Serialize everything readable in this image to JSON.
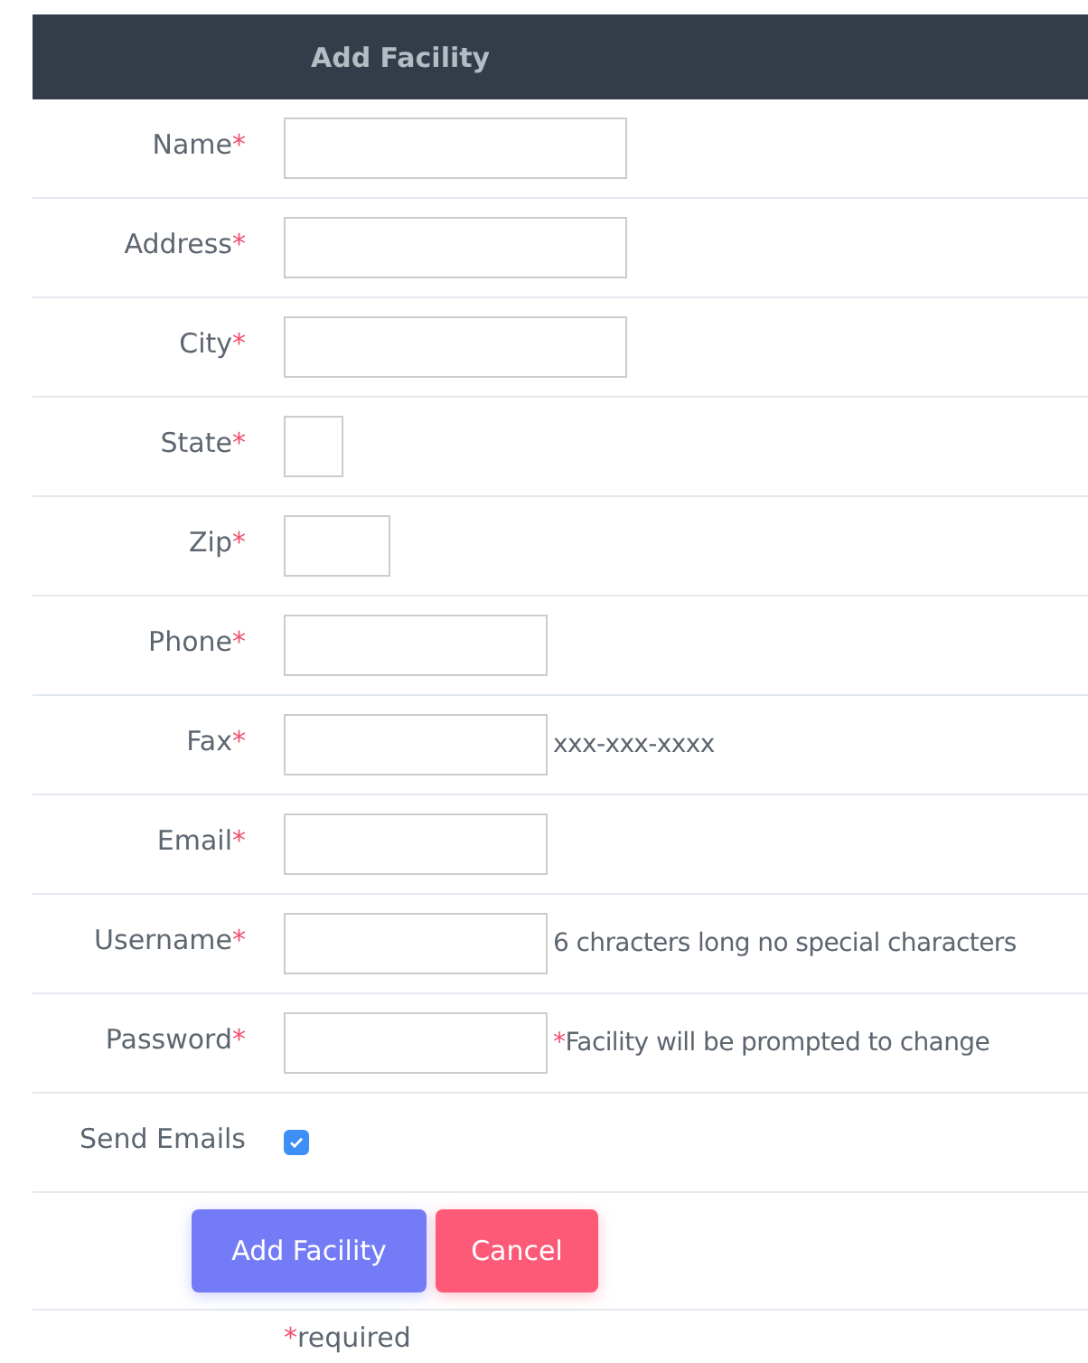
{
  "header": {
    "title": "Add Facility"
  },
  "fields": [
    {
      "kind": "wide",
      "label": "Name",
      "mark": "*"
    },
    {
      "kind": "wide",
      "label": "Address",
      "mark": "*"
    },
    {
      "kind": "wide",
      "label": "City",
      "mark": "*"
    },
    {
      "kind": "tiny",
      "label": "State",
      "mark": "*"
    },
    {
      "kind": "short",
      "label": "Zip",
      "mark": "*"
    },
    {
      "kind": "medium",
      "label": "Phone",
      "mark": "*"
    },
    {
      "kind": "medium",
      "label": "Fax",
      "mark": "*",
      "hint": "xxx-xxx-xxxx"
    },
    {
      "kind": "medium",
      "label": "Email",
      "mark": "*"
    },
    {
      "kind": "medium",
      "label": "Username",
      "mark": "*",
      "hint": "6 chracters long no special characters"
    },
    {
      "kind": "medium",
      "label": "Password",
      "mark": "*",
      "hint_mark": "*",
      "hint": "Facility will be prompted to change"
    },
    {
      "kind": "checkbox",
      "label": "Send Emails",
      "checked": true
    }
  ],
  "buttons": [
    {
      "kind": "primary",
      "label": "Add Facility"
    },
    {
      "kind": "danger",
      "label": "Cancel"
    }
  ],
  "footer": {
    "mark": "*",
    "text": "required"
  }
}
